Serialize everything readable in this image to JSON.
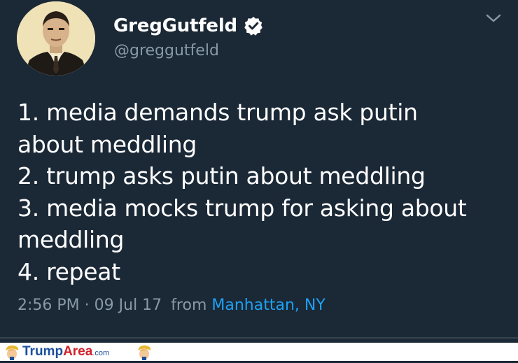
{
  "tweet": {
    "display_name": "GregGutfeld",
    "handle": "@greggutfeld",
    "text_lines": [
      "1. media demands trump ask putin",
      "about meddling",
      "2. trump asks putin about meddling",
      "3. media mocks trump for asking about",
      "meddling",
      "4. repeat"
    ],
    "time": "2:56 PM",
    "separator": "·",
    "date": "09 Jul 17",
    "from_label": "from",
    "location": "Manhattan, NY"
  },
  "icons": {
    "verified": "verified-badge-icon",
    "menu": "chevron-down-icon"
  },
  "watermark": {
    "brand_part1": "Trump",
    "brand_part2": "Area",
    "brand_suffix": ".com"
  },
  "colors": {
    "background": "#1b2836",
    "text": "#ffffff",
    "muted": "#8899a6",
    "link": "#1da1f2",
    "brand_blue": "#1b4f9c",
    "brand_red": "#d0202a"
  }
}
